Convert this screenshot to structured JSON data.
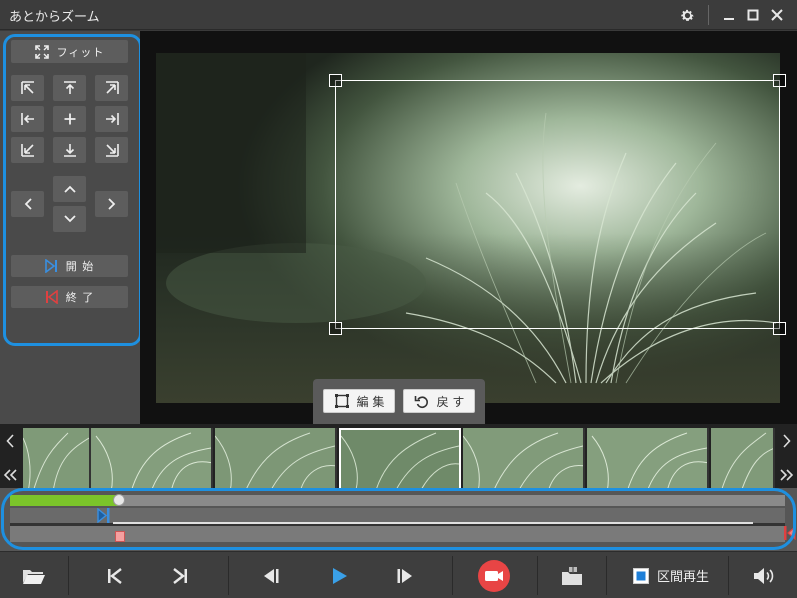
{
  "app": {
    "title": "あとからズーム"
  },
  "window_controls": {
    "settings": "gear-icon",
    "minimize": "minimize-icon",
    "maximize": "maximize-icon",
    "close": "close-icon"
  },
  "left_panel": {
    "fit_label": "フィット",
    "start_label": "開 始",
    "end_label": "終 了"
  },
  "edit_bar": {
    "edit_label": "編 集",
    "undo_label": "戻 す"
  },
  "timeline": {
    "played_fraction": 0.14,
    "start_marker_fraction": 0.125,
    "end_marker_fraction": 1.0
  },
  "toolbar": {
    "range_play_label": "区間再生",
    "record_color": "#e84545",
    "play_color": "#3aa0e8"
  },
  "colors": {
    "accent_outline": "#1e90e0",
    "progress_green": "#7bc42a",
    "start_marker": "#3a8fe0",
    "end_marker": "#e04040"
  }
}
